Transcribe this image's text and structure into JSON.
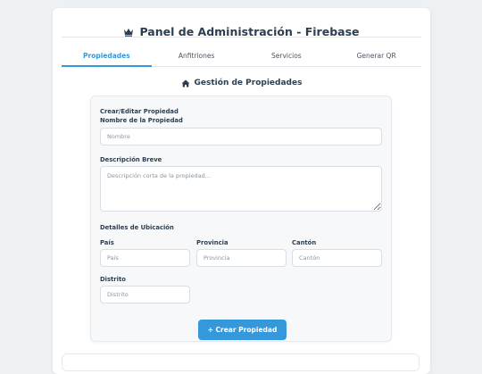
{
  "header": {
    "icon": "crown-icon",
    "title": "Panel de Administración - Firebase"
  },
  "tabs": [
    {
      "label": "Propiedades",
      "active": true
    },
    {
      "label": "Anfitriones",
      "active": false
    },
    {
      "label": "Servicios",
      "active": false
    },
    {
      "label": "Generar QR",
      "active": false
    }
  ],
  "section": {
    "icon": "home-icon",
    "title": "Gestión de Propiedades"
  },
  "form": {
    "heading": "Crear/Editar Propiedad",
    "name_label": "Nombre de la Propiedad",
    "name_placeholder": "Nombre",
    "desc_label": "Descripción Breve",
    "desc_placeholder": "Descripción corta de la propiedad...",
    "location_label": "Detalles de Ubicación",
    "pais_label": "País",
    "pais_placeholder": "País",
    "provincia_label": "Provincia",
    "provincia_placeholder": "Provincia",
    "canton_label": "Cantón",
    "canton_placeholder": "Cantón",
    "distrito_label": "Distrito",
    "distrito_placeholder": "Distrito",
    "submit_label": "+ Crear Propiedad"
  },
  "colors": {
    "accent": "#3498db",
    "text": "#2c3e50",
    "background": "#eef1f4"
  }
}
